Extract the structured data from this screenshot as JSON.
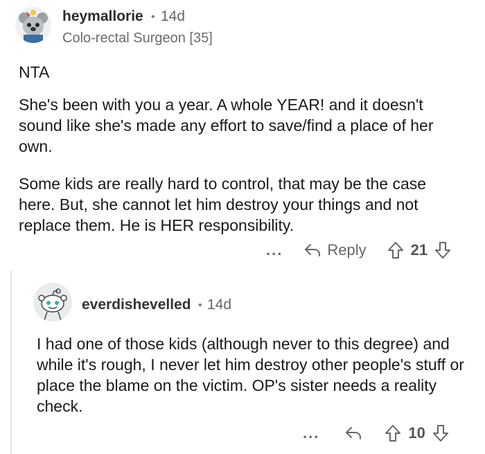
{
  "comments": [
    {
      "username": "heymallorie",
      "dot": "•",
      "time": "14d",
      "flair": "Colo-rectal Surgeon [35]",
      "paragraphs": [
        "NTA",
        "She's been with you a year. A whole YEAR! and it doesn't sound like she's made any effort to save/find a place of her own.",
        "Some kids are really hard to control, that may be the case here. But, she cannot let him destroy your things and not replace them. He is HER responsibility."
      ],
      "more": "...",
      "reply_label": "Reply",
      "votes": "21"
    },
    {
      "username": "everdishevelled",
      "dot": "•",
      "time": "14d",
      "paragraphs": [
        "I had one of those kids (although never to this degree) and while it's rough, I never let him destroy other people's stuff or place the blame on the victim. OP's sister needs a reality check."
      ],
      "more": "...",
      "votes": "10"
    }
  ],
  "icons": {
    "reply": "reply-arrow-icon",
    "upvote": "upvote-arrow-icon",
    "downvote": "downvote-arrow-icon"
  },
  "colors": {
    "text": "#1a1a1b",
    "meta": "#666666",
    "thread_line": "#e3e3e3"
  }
}
